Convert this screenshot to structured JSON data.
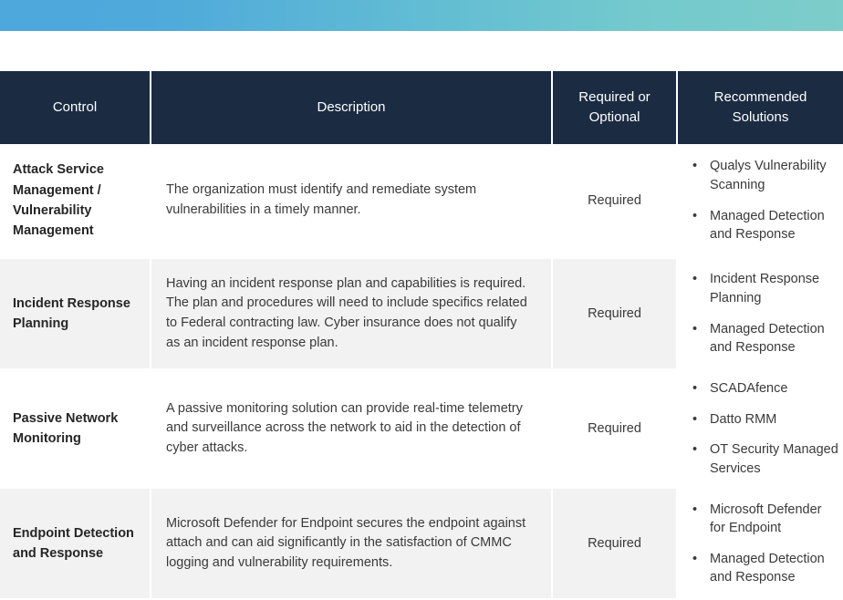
{
  "banner": {
    "gradient_start": "#4ea8dc",
    "gradient_end": "#7dcdca"
  },
  "table": {
    "header_background": "#1b2c42",
    "header_text_color": "#ffffff",
    "shade_color": "#f2f2f2",
    "columns": [
      {
        "key": "control",
        "label": "Control"
      },
      {
        "key": "description",
        "label": "Description"
      },
      {
        "key": "required",
        "label": "Required or Optional"
      },
      {
        "key": "solutions",
        "label": "Recommended Solutions"
      }
    ],
    "column_labels_wrapped": {
      "required_line1": "Required or",
      "required_line2": "Optional",
      "solutions_line1": "Recommended",
      "solutions_line2": "Solutions"
    },
    "bullet_glyph": "•",
    "rows": [
      {
        "control": "Attack Service Management / Vulnerability Management",
        "description": "The organization must identify and remediate system vulnerabilities in a timely manner.",
        "required": "Required",
        "solutions": [
          "Qualys Vulnerability Scanning",
          "Managed Detection and Response"
        ],
        "shaded": false
      },
      {
        "control": "Incident Response Planning",
        "description": "Having an incident response plan and capabilities is required. The plan and procedures will need to include specifics related to Federal contracting law. Cyber insurance does not qualify as an incident response plan.",
        "required": "Required",
        "solutions": [
          "Incident Response Planning",
          "Managed Detection and Response"
        ],
        "shaded": true
      },
      {
        "control": "Passive Network Monitoring",
        "description": "A passive monitoring solution can provide real-time telemetry and surveillance across the network to aid in the detection of cyber attacks.",
        "required": "Required",
        "solutions": [
          "SCADAfence",
          "Datto RMM",
          "OT Security Managed Services"
        ],
        "shaded": false
      },
      {
        "control": "Endpoint Detection and Response",
        "description": "Microsoft Defender for Endpoint secures the endpoint against attach and can aid significantly in the satisfaction of CMMC logging and vulnerability requirements.",
        "required": "Required",
        "solutions": [
          "Microsoft Defender for Endpoint",
          "Managed Detection and Response"
        ],
        "shaded": true
      }
    ]
  }
}
